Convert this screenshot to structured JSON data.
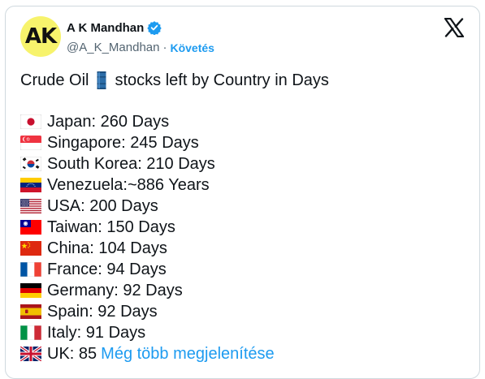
{
  "author": {
    "avatar_text": "AK",
    "name": "A K Mandhan",
    "handle": "@A_K_Mandhan",
    "separator": "·",
    "follow_label": "Követés"
  },
  "icons": {
    "verified": "verified-badge-icon",
    "x_logo": "x-logo-icon",
    "barrel": "oil-barrel-icon"
  },
  "colors": {
    "link": "#1d9bf0",
    "verified": "#1d9bf0",
    "avatar_bg": "#f7f36c",
    "text": "#0f1419",
    "muted": "#536471"
  },
  "tweet": {
    "headline_part1": "Crude Oil",
    "headline_part2": "stocks left by Country in Days",
    "items": [
      {
        "flag": "japan-flag-icon",
        "text": "Japan: 260 Days"
      },
      {
        "flag": "singapore-flag-icon",
        "text": "Singapore: 245 Days"
      },
      {
        "flag": "south-korea-flag-icon",
        "text": "South Korea: 210 Days"
      },
      {
        "flag": "venezuela-flag-icon",
        "text": "Venezuela:~886 Years"
      },
      {
        "flag": "usa-flag-icon",
        "text": "USA: 200 Days"
      },
      {
        "flag": "taiwan-flag-icon",
        "text": "Taiwan: 150 Days"
      },
      {
        "flag": "china-flag-icon",
        "text": "China: 104 Days"
      },
      {
        "flag": "france-flag-icon",
        "text": "France: 94 Days"
      },
      {
        "flag": "germany-flag-icon",
        "text": "Germany: 92 Days"
      },
      {
        "flag": "spain-flag-icon",
        "text": "Spain: 92 Days"
      },
      {
        "flag": "italy-flag-icon",
        "text": "Italy: 91 Days"
      },
      {
        "flag": "uk-flag-icon",
        "text": "UK: 85"
      }
    ],
    "show_more_label": "Még több megjelenítése"
  }
}
